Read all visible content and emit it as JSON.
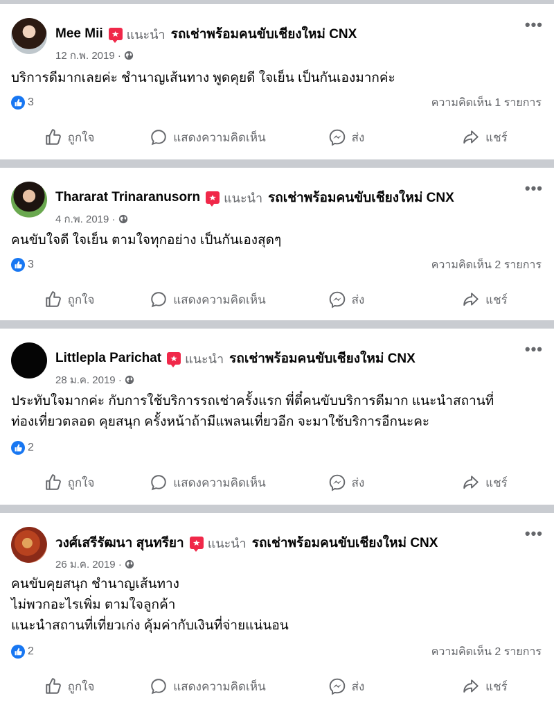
{
  "ui": {
    "recommend_label": "แนะนำ",
    "page_name": "รถเช่าพร้อมคนขับเชียงใหม่ CNX",
    "action_like": "ถูกใจ",
    "action_comment": "แสดงความคิดเห็น",
    "action_send": "ส่ง",
    "action_share": "แชร์",
    "more_label": "•••"
  },
  "colors": {
    "recommend_badge": "#f02849",
    "like_blue": "#1877f2",
    "secondary_text": "#65676b"
  },
  "posts": [
    {
      "author": "Mee Mii",
      "date": "12 ก.พ. 2019 ·",
      "body": [
        "บริการดีมากเลยค่ะ ชำนาญเส้นทาง พูดคุยดี ใจเย็น เป็นกันเองมากค่ะ"
      ],
      "likes": "3",
      "comments": "ความคิดเห็น 1 รายการ"
    },
    {
      "author": "Thararat Trinaranusorn",
      "date": "4 ก.พ. 2019 ·",
      "body": [
        "คนขับใจดี ใจเย็น ตามใจทุกอย่าง เป็นกันเองสุดๆ"
      ],
      "likes": "3",
      "comments": "ความคิดเห็น 2 รายการ"
    },
    {
      "author": "Littlepla Parichat",
      "date": "28 ม.ค. 2019 ·",
      "body": [
        "ประทับใจมากค่ะ กับการใช้บริการรถเช่าครั้งแรก พี่ตี๋คนขับบริการดีมาก แนะนำสถานที่",
        "ท่องเที่ยวตลอด คุยสนุก ครั้งหน้าถ้ามีแพลนเที่ยวอีก จะมาใช้บริการอีกนะคะ"
      ],
      "likes": "2",
      "comments": ""
    },
    {
      "author": "วงศ์เสรีรัฒนา สุนทรียา",
      "date": "26 ม.ค. 2019 ·",
      "body": [
        "คนขับคุยสนุก ชำนาญเส้นทาง",
        "ไม่พวกอะไรเพิ่ม ตามใจลูกค้า",
        "แนะนำสถานที่เที่ยวเก่ง คุ้มค่ากับเงินที่จ่ายแน่นอน"
      ],
      "likes": "2",
      "comments": "ความคิดเห็น 2 รายการ"
    }
  ]
}
